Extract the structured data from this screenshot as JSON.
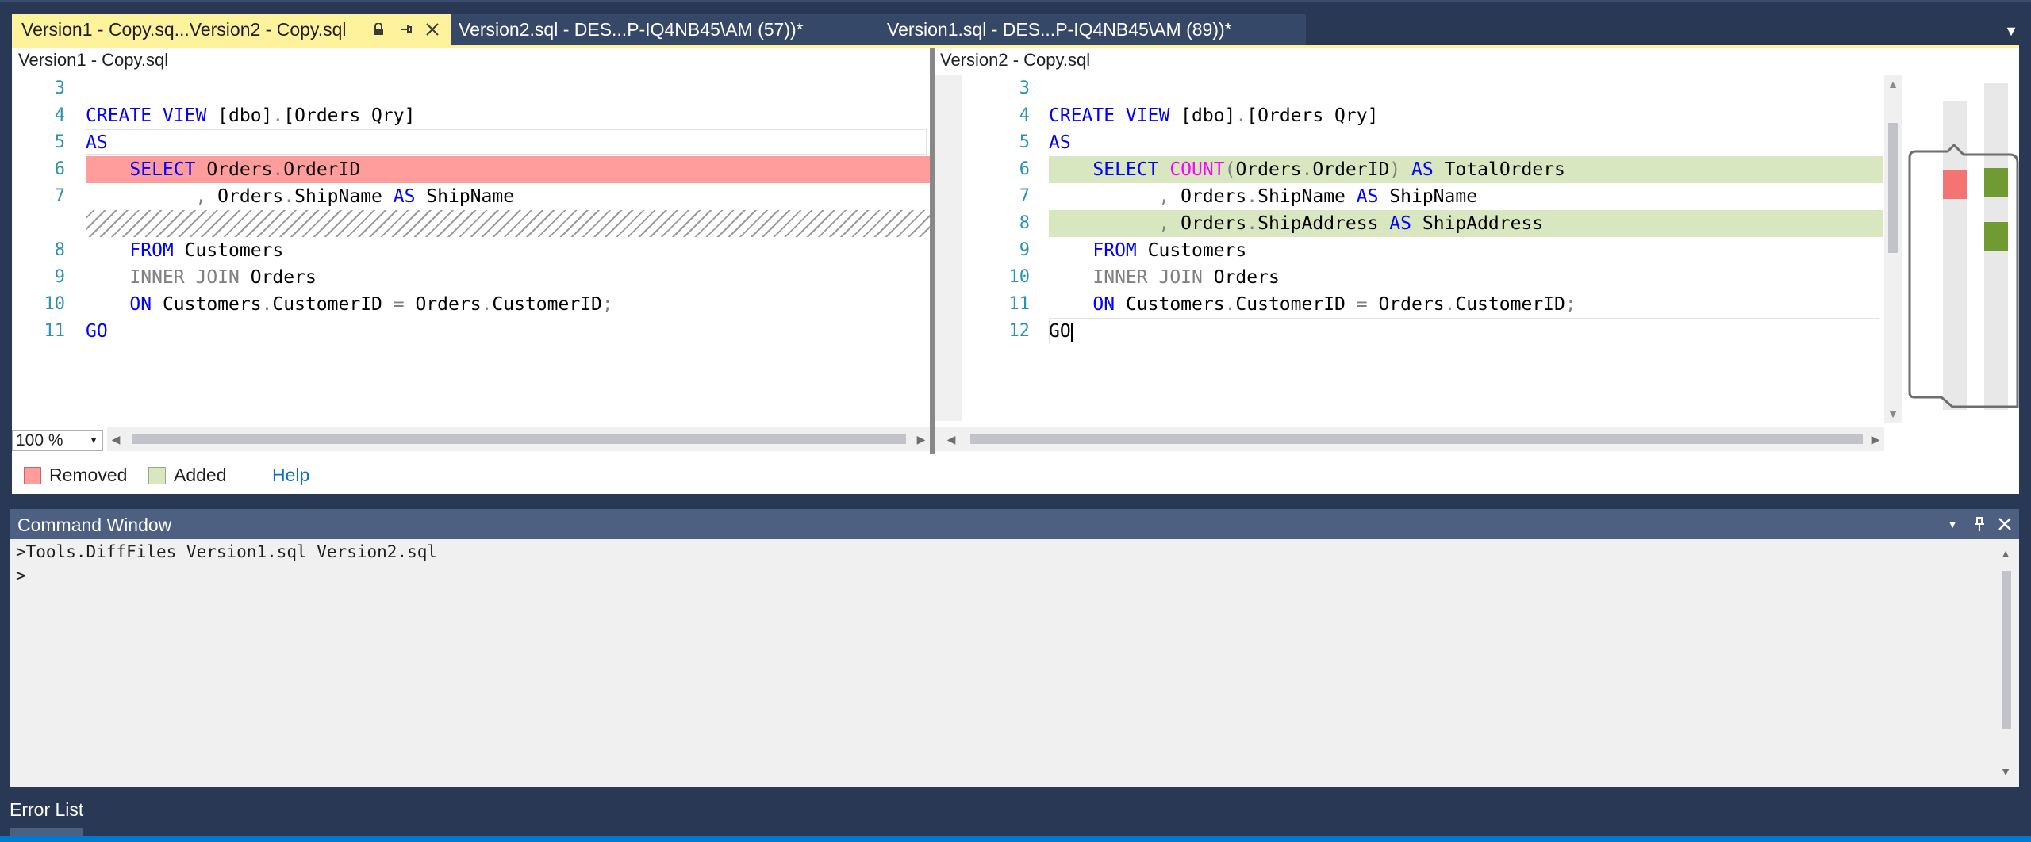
{
  "tabs": [
    {
      "label": "Version1 - Copy.sq...Version2 - Copy.sql",
      "active": true
    },
    {
      "label": "Version2.sql - DES...P-IQ4NB45\\AM (57))*"
    },
    {
      "label": "Version1.sql - DES...P-IQ4NB45\\AM (89))*"
    }
  ],
  "icons": {
    "lock": "🔒",
    "pin": "⊣",
    "close": "✕",
    "overflow": "▼",
    "scroll_up": "▲",
    "scroll_down": "▼",
    "scroll_left": "◀",
    "scroll_right": "▶",
    "dropdown": "▼",
    "minimize": "▾",
    "pin_window": "⊥",
    "close_window": "✕"
  },
  "left_pane": {
    "title": "Version1 - Copy.sql",
    "line_numbers": [
      "3",
      "4",
      "5",
      "6",
      "7",
      "",
      "8",
      "9",
      "10",
      "11"
    ],
    "lines": [
      {
        "n": "3",
        "parts": []
      },
      {
        "n": "4",
        "parts": [
          {
            "t": "CREATE VIEW ",
            "c": "kw"
          },
          {
            "t": "[dbo]",
            "c": ""
          },
          {
            "t": ".",
            "c": "gray"
          },
          {
            "t": "[Orders Qry]",
            "c": ""
          }
        ]
      },
      {
        "n": "5",
        "parts": [
          {
            "t": "AS",
            "c": "kw"
          }
        ]
      },
      {
        "n": "6",
        "parts": [
          {
            "t": "    SELECT ",
            "c": "kw"
          },
          {
            "t": "Orders",
            "c": ""
          },
          {
            "t": ".",
            "c": "gray"
          },
          {
            "t": "OrderID",
            "c": ""
          }
        ],
        "hl": "removed"
      },
      {
        "n": "7",
        "parts": [
          {
            "t": "          , ",
            "c": "gray"
          },
          {
            "t": "Orders",
            "c": ""
          },
          {
            "t": ".",
            "c": "gray"
          },
          {
            "t": "ShipName ",
            "c": ""
          },
          {
            "t": "AS ",
            "c": "kw"
          },
          {
            "t": "ShipName",
            "c": ""
          }
        ]
      },
      {
        "n": "",
        "parts": [],
        "hl": "hatch"
      },
      {
        "n": "8",
        "parts": [
          {
            "t": "    FROM ",
            "c": "kw"
          },
          {
            "t": "Customers",
            "c": ""
          }
        ]
      },
      {
        "n": "9",
        "parts": [
          {
            "t": "    INNER JOIN ",
            "c": "gray"
          },
          {
            "t": "Orders",
            "c": ""
          }
        ]
      },
      {
        "n": "10",
        "parts": [
          {
            "t": "    ON ",
            "c": "kw"
          },
          {
            "t": "Customers",
            "c": ""
          },
          {
            "t": ".",
            "c": "gray"
          },
          {
            "t": "CustomerID ",
            "c": ""
          },
          {
            "t": "= ",
            "c": "gray"
          },
          {
            "t": "Orders",
            "c": ""
          },
          {
            "t": ".",
            "c": "gray"
          },
          {
            "t": "CustomerID",
            "c": ""
          },
          {
            "t": ";",
            "c": "gray"
          }
        ]
      },
      {
        "n": "11",
        "parts": [
          {
            "t": "GO",
            "c": "kw"
          }
        ]
      }
    ]
  },
  "right_pane": {
    "title": "Version2 - Copy.sql",
    "lines": [
      {
        "n": "3",
        "parts": []
      },
      {
        "n": "4",
        "parts": [
          {
            "t": "CREATE VIEW ",
            "c": "kw"
          },
          {
            "t": "[dbo]",
            "c": ""
          },
          {
            "t": ".",
            "c": "gray"
          },
          {
            "t": "[Orders Qry]",
            "c": ""
          }
        ]
      },
      {
        "n": "5",
        "parts": [
          {
            "t": "AS",
            "c": "kw"
          }
        ]
      },
      {
        "n": "6",
        "parts": [
          {
            "t": "    SELECT ",
            "c": "kw"
          },
          {
            "t": "COUNT",
            "c": "fn"
          },
          {
            "t": "(",
            "c": "gray"
          },
          {
            "t": "Orders",
            "c": ""
          },
          {
            "t": ".",
            "c": "gray"
          },
          {
            "t": "OrderID",
            "c": ""
          },
          {
            "t": ") ",
            "c": "gray"
          },
          {
            "t": "AS ",
            "c": "kw"
          },
          {
            "t": "TotalOrders",
            "c": ""
          }
        ],
        "hl": "added"
      },
      {
        "n": "7",
        "parts": [
          {
            "t": "          , ",
            "c": "gray"
          },
          {
            "t": "Orders",
            "c": ""
          },
          {
            "t": ".",
            "c": "gray"
          },
          {
            "t": "ShipName ",
            "c": ""
          },
          {
            "t": "AS ",
            "c": "kw"
          },
          {
            "t": "ShipName",
            "c": ""
          }
        ]
      },
      {
        "n": "8",
        "parts": [
          {
            "t": "          , ",
            "c": "gray"
          },
          {
            "t": "Orders",
            "c": ""
          },
          {
            "t": ".",
            "c": "gray"
          },
          {
            "t": "ShipAddress ",
            "c": ""
          },
          {
            "t": "AS ",
            "c": "kw"
          },
          {
            "t": "ShipAddress",
            "c": ""
          }
        ],
        "hl": "added"
      },
      {
        "n": "9",
        "parts": [
          {
            "t": "    FROM ",
            "c": "kw"
          },
          {
            "t": "Customers",
            "c": ""
          }
        ]
      },
      {
        "n": "10",
        "parts": [
          {
            "t": "    INNER JOIN ",
            "c": "gray"
          },
          {
            "t": "Orders",
            "c": ""
          }
        ]
      },
      {
        "n": "11",
        "parts": [
          {
            "t": "    ON ",
            "c": "kw"
          },
          {
            "t": "Customers",
            "c": ""
          },
          {
            "t": ".",
            "c": "gray"
          },
          {
            "t": "CustomerID ",
            "c": ""
          },
          {
            "t": "= ",
            "c": "gray"
          },
          {
            "t": "Orders",
            "c": ""
          },
          {
            "t": ".",
            "c": "gray"
          },
          {
            "t": "CustomerID",
            "c": ""
          },
          {
            "t": ";",
            "c": "gray"
          }
        ]
      },
      {
        "n": "12",
        "parts": [
          {
            "t": "GO",
            "c": ""
          }
        ],
        "caret": true
      }
    ]
  },
  "zoom": "100 %",
  "legend": {
    "removed": "Removed",
    "added": "Added",
    "help": "Help"
  },
  "colors": {
    "removed": "#ff9c9c",
    "added": "#d9e7c0",
    "overview_removed": "#f47373",
    "overview_added": "#6f9b32",
    "keyword": "#0000ff",
    "function": "#ff00ff",
    "line_number": "#2b91af",
    "tab_active": "#fff29d",
    "chrome": "#293955"
  },
  "command_window": {
    "title": "Command Window",
    "lines": [
      ">Tools.DiffFiles Version1.sql Version2.sql",
      ">"
    ]
  },
  "bottom_tab": "Error List"
}
